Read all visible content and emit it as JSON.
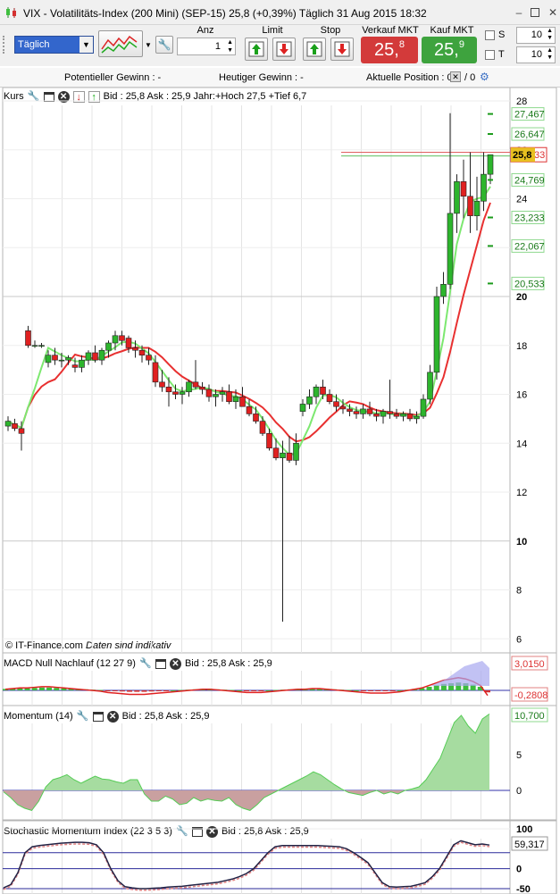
{
  "window": {
    "title": "VIX - Volatilitäts-Index (200 Mini) (SEP-15)    25,8 (+0,39%)    Täglich  31 Aug 2015 18:32"
  },
  "toolbar": {
    "period": "Täglich",
    "anz_label": "Anz",
    "anz_value": "1",
    "limit_label": "Limit",
    "stop_label": "Stop",
    "sell_label": "Verkauf MKT",
    "sell_price_main": "25,",
    "sell_price_sub": "8",
    "buy_label": "Kauf MKT",
    "buy_price_main": "25,",
    "buy_price_sub": "9",
    "s_label": "S",
    "s_value": "10",
    "t_label": "T",
    "t_value": "10"
  },
  "info": {
    "pot_gewinn": "Potentieller Gewinn : -",
    "heut_gewinn": "Heutiger Gewinn : -",
    "akt_position": "Aktuelle Position : 0",
    "position_count": "/ 0"
  },
  "colors": {
    "candle_up": "#2db52d",
    "candle_down": "#e02020",
    "ma_red": "#e83030",
    "ma_green": "#7de870",
    "sell": "#d33a3a",
    "buy": "#3ea33e"
  },
  "panels": {
    "kurs": {
      "title": "Kurs",
      "info": "Bid : 25,8 Ask : 25,9  Jahr:+Hoch 27,5 +Tief 6,7",
      "copyright": "© IT-Finance.com",
      "disclaimer": "Daten sind indikativ",
      "ticks": [
        "28",
        "26",
        "24",
        "22",
        "20",
        "18",
        "16",
        "14",
        "12",
        "10",
        "8",
        "6"
      ],
      "price_tag": "25,8",
      "price_tag_behind": "33",
      "level_labels": [
        "27,467",
        "26,647",
        "24,769",
        "23,233",
        "22,067",
        "20,533"
      ]
    },
    "macd": {
      "title": "MACD Null Nachlauf (12 27 9)",
      "info": "Bid : 25,8 Ask : 25,9",
      "val_top": "3,0150",
      "val_bottom": "-0,2808"
    },
    "momentum": {
      "title": "Momentum (14)",
      "info": "Bid : 25,8 Ask : 25,9",
      "val_top": "10,700",
      "ticks": [
        "5",
        "0"
      ]
    },
    "stoch": {
      "title": "Stochastic Momentum Index (22 3 5 3)",
      "info": "Bid : 25,8 Ask : 25,9",
      "ticks": [
        "100",
        "0",
        "-50"
      ],
      "val_top": "59,317"
    }
  },
  "chart_data": [
    {
      "type": "candlestick",
      "title": "VIX - Volatilitäts-Index (200 Mini) (SEP-15)",
      "ylim": [
        5.8,
        28.5
      ],
      "candles": [
        [
          14.7,
          15.1,
          14.5,
          14.9
        ],
        [
          14.8,
          15.0,
          14.5,
          14.6
        ],
        [
          14.6,
          14.9,
          13.7,
          14.4
        ],
        [
          18.6,
          18.8,
          17.9,
          18.0
        ],
        [
          18.0,
          18.2,
          17.9,
          18.0
        ],
        [
          18.0,
          18.1,
          17.9,
          18.0
        ],
        [
          17.3,
          17.8,
          17.1,
          17.6
        ],
        [
          17.6,
          17.9,
          17.2,
          17.4
        ],
        [
          17.4,
          17.7,
          17.1,
          17.4
        ],
        [
          17.4,
          17.6,
          17.2,
          17.5
        ],
        [
          17.2,
          17.5,
          16.9,
          17.1
        ],
        [
          17.1,
          17.6,
          16.9,
          17.4
        ],
        [
          17.4,
          17.8,
          17.2,
          17.7
        ],
        [
          17.7,
          18.0,
          17.3,
          17.4
        ],
        [
          17.4,
          17.9,
          17.2,
          17.8
        ],
        [
          17.8,
          18.2,
          17.5,
          18.1
        ],
        [
          18.1,
          18.6,
          17.8,
          18.4
        ],
        [
          18.4,
          18.6,
          18.0,
          18.2
        ],
        [
          18.3,
          18.4,
          17.7,
          17.9
        ],
        [
          17.9,
          18.2,
          17.5,
          17.8
        ],
        [
          17.8,
          18.0,
          17.3,
          17.6
        ],
        [
          17.6,
          17.9,
          17.2,
          17.4
        ],
        [
          17.3,
          17.6,
          16.3,
          16.5
        ],
        [
          16.5,
          17.0,
          16.1,
          16.3
        ],
        [
          16.3,
          16.7,
          15.5,
          16.1
        ],
        [
          16.1,
          16.4,
          15.8,
          16.0
        ],
        [
          16.0,
          16.3,
          15.6,
          16.1
        ],
        [
          16.1,
          16.6,
          15.9,
          16.5
        ],
        [
          16.5,
          17.4,
          16.2,
          16.3
        ],
        [
          16.3,
          16.5,
          16.0,
          16.2
        ],
        [
          16.2,
          16.4,
          15.7,
          15.9
        ],
        [
          15.9,
          16.2,
          15.5,
          16.0
        ],
        [
          16.0,
          16.3,
          15.7,
          16.1
        ],
        [
          16.1,
          16.4,
          15.6,
          15.7
        ],
        [
          15.7,
          16.2,
          15.4,
          15.9
        ],
        [
          15.9,
          16.3,
          15.5,
          15.5
        ],
        [
          15.5,
          15.8,
          15.1,
          15.2
        ],
        [
          15.2,
          15.5,
          14.8,
          14.9
        ],
        [
          14.9,
          15.1,
          14.3,
          14.4
        ],
        [
          14.4,
          14.6,
          13.7,
          13.8
        ],
        [
          13.8,
          14.2,
          13.3,
          13.4
        ],
        [
          13.4,
          14.1,
          6.7,
          13.6
        ],
        [
          13.6,
          14.3,
          13.2,
          13.3
        ],
        [
          13.3,
          14.4,
          13.1,
          14.0
        ],
        [
          15.3,
          15.8,
          15.1,
          15.6
        ],
        [
          15.6,
          16.2,
          15.4,
          15.9
        ],
        [
          15.9,
          16.4,
          15.6,
          16.3
        ],
        [
          16.3,
          16.6,
          15.8,
          16.0
        ],
        [
          16.0,
          16.2,
          15.6,
          15.7
        ],
        [
          15.7,
          16.0,
          15.3,
          15.5
        ],
        [
          15.5,
          15.8,
          15.2,
          15.4
        ],
        [
          15.4,
          15.6,
          15.1,
          15.3
        ],
        [
          15.3,
          15.5,
          15.0,
          15.2
        ],
        [
          15.2,
          15.6,
          15.0,
          15.4
        ],
        [
          15.4,
          15.7,
          15.1,
          15.2
        ],
        [
          15.2,
          15.4,
          14.9,
          15.1
        ],
        [
          15.1,
          15.4,
          14.8,
          15.3
        ],
        [
          15.3,
          16.6,
          15.0,
          15.2
        ],
        [
          15.2,
          15.4,
          15.0,
          15.1
        ],
        [
          15.1,
          15.3,
          14.9,
          15.2
        ],
        [
          15.2,
          15.4,
          14.9,
          15.0
        ],
        [
          15.0,
          15.3,
          14.8,
          15.1
        ],
        [
          15.1,
          16.0,
          15.0,
          15.8
        ],
        [
          15.8,
          17.2,
          15.6,
          16.9
        ],
        [
          16.9,
          20.4,
          16.6,
          20.0
        ],
        [
          20.0,
          21.0,
          19.7,
          20.5
        ],
        [
          20.5,
          27.5,
          20.3,
          23.4
        ],
        [
          23.4,
          25.0,
          22.6,
          24.7
        ],
        [
          24.7,
          25.6,
          23.2,
          24.1
        ],
        [
          24.1,
          25.9,
          22.6,
          23.3
        ],
        [
          23.3,
          24.9,
          22.7,
          23.9
        ],
        [
          23.9,
          25.9,
          23.5,
          25.0
        ],
        [
          25.0,
          25.6,
          24.6,
          25.8
        ]
      ]
    },
    {
      "type": "bar",
      "title": "MACD Null Nachlauf (12 27 9)",
      "ylim": [
        -1.2,
        3.3
      ],
      "histogram": [
        0.2,
        0.25,
        0.3,
        0.3,
        0.35,
        0.4,
        0.4,
        0.35,
        0.3,
        0.25,
        0.2,
        0.15,
        0.1,
        0.05,
        -0.05,
        -0.1,
        -0.15,
        -0.2,
        -0.2,
        -0.2,
        -0.15,
        -0.1,
        -0.05,
        0.0,
        0.05,
        0.1,
        0.15,
        0.2,
        0.2,
        0.15,
        0.1,
        0.05,
        0.0,
        -0.05,
        -0.05,
        -0.05,
        0.0,
        0.05,
        0.1,
        0.15,
        0.2,
        0.2,
        0.25,
        0.25,
        0.2,
        0.15,
        0.1,
        0.05,
        0.0,
        -0.05,
        -0.1,
        -0.1,
        -0.1,
        -0.05,
        0.0,
        0.1,
        0.2,
        0.3,
        0.5,
        0.7,
        0.9,
        1.0,
        1.1,
        1.0,
        0.8,
        0.5,
        -0.28
      ]
    },
    {
      "type": "area",
      "title": "Momentum (14)",
      "ylim": [
        -3.5,
        11.5
      ],
      "values": [
        -0.2,
        -1.0,
        -2.0,
        -2.5,
        -2.8,
        -1.5,
        0.5,
        1.5,
        1.8,
        2.2,
        1.5,
        1.0,
        1.5,
        2.0,
        1.6,
        1.5,
        1.2,
        1.0,
        1.5,
        1.5,
        -0.5,
        -1.5,
        -1.5,
        -0.8,
        -1.2,
        -2.0,
        -1.8,
        -1.0,
        -1.5,
        -1.2,
        -1.4,
        -1.5,
        -1.0,
        -2.0,
        -2.5,
        -2.8,
        -2.0,
        -1.0,
        -0.5,
        0.0,
        0.5,
        1.0,
        1.5,
        2.0,
        2.6,
        2.2,
        1.5,
        0.8,
        0.2,
        -0.3,
        -0.5,
        -0.7,
        -0.3,
        0.0,
        -0.5,
        -0.2,
        -0.5,
        0.0,
        0.2,
        0.5,
        1.5,
        3.0,
        4.5,
        7.0,
        9.5,
        10.5,
        9.0,
        8.0,
        10.0,
        10.7
      ]
    },
    {
      "type": "line",
      "title": "Stochastic Momentum Index (22 3 5 3)",
      "ylim": [
        -55,
        105
      ],
      "values": [
        -48,
        -40,
        -10,
        40,
        55,
        58,
        60,
        62,
        64,
        65,
        66,
        66,
        65,
        60,
        40,
        0,
        -30,
        -45,
        -48,
        -50,
        -50,
        -49,
        -48,
        -46,
        -45,
        -44,
        -42,
        -40,
        -38,
        -36,
        -34,
        -30,
        -26,
        -20,
        -12,
        0,
        20,
        40,
        55,
        58,
        58,
        58,
        58,
        58,
        58,
        57,
        56,
        55,
        50,
        40,
        28,
        15,
        -10,
        -35,
        -45,
        -46,
        -45,
        -44,
        -40,
        -35,
        -20,
        0,
        30,
        60,
        70,
        65,
        60,
        62,
        59.3
      ]
    }
  ]
}
